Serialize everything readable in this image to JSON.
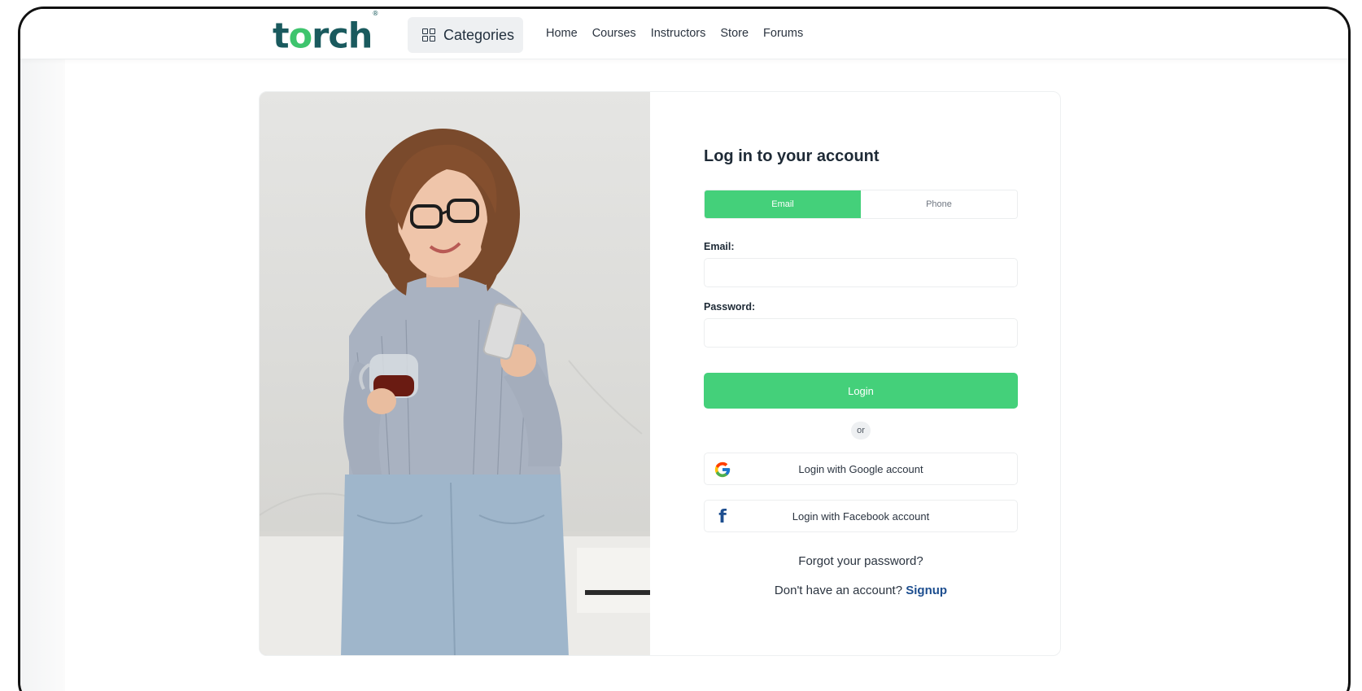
{
  "header": {
    "logo_text": "torch",
    "logo_colors": {
      "primary": "#1a5a5e",
      "accent": "#3ec46d"
    },
    "categories_label": "Categories",
    "categories_icon": "grid-icon",
    "nav": [
      "Home",
      "Courses",
      "Instructors",
      "Store",
      "Forums"
    ]
  },
  "hero_image": {
    "subject": "woman-with-phone-and-tea"
  },
  "login": {
    "title": "Log in to your account",
    "tabs": {
      "email": "Email",
      "phone": "Phone",
      "active": "Email"
    },
    "email_label": "Email:",
    "email_value": "",
    "password_label": "Password:",
    "password_value": "",
    "login_button": "Login",
    "or_text": "or",
    "google_button": "Login with Google account",
    "google_icon": "google-icon",
    "facebook_button": "Login with Facebook account",
    "facebook_icon": "facebook-icon",
    "forgot_password": "Forgot your password?",
    "no_account_text": "Don't have an account?",
    "signup_link": "Signup"
  },
  "colors": {
    "brand_green": "#44d07a",
    "text_dark": "#1e2a36",
    "link_blue": "#1d4e8f"
  }
}
